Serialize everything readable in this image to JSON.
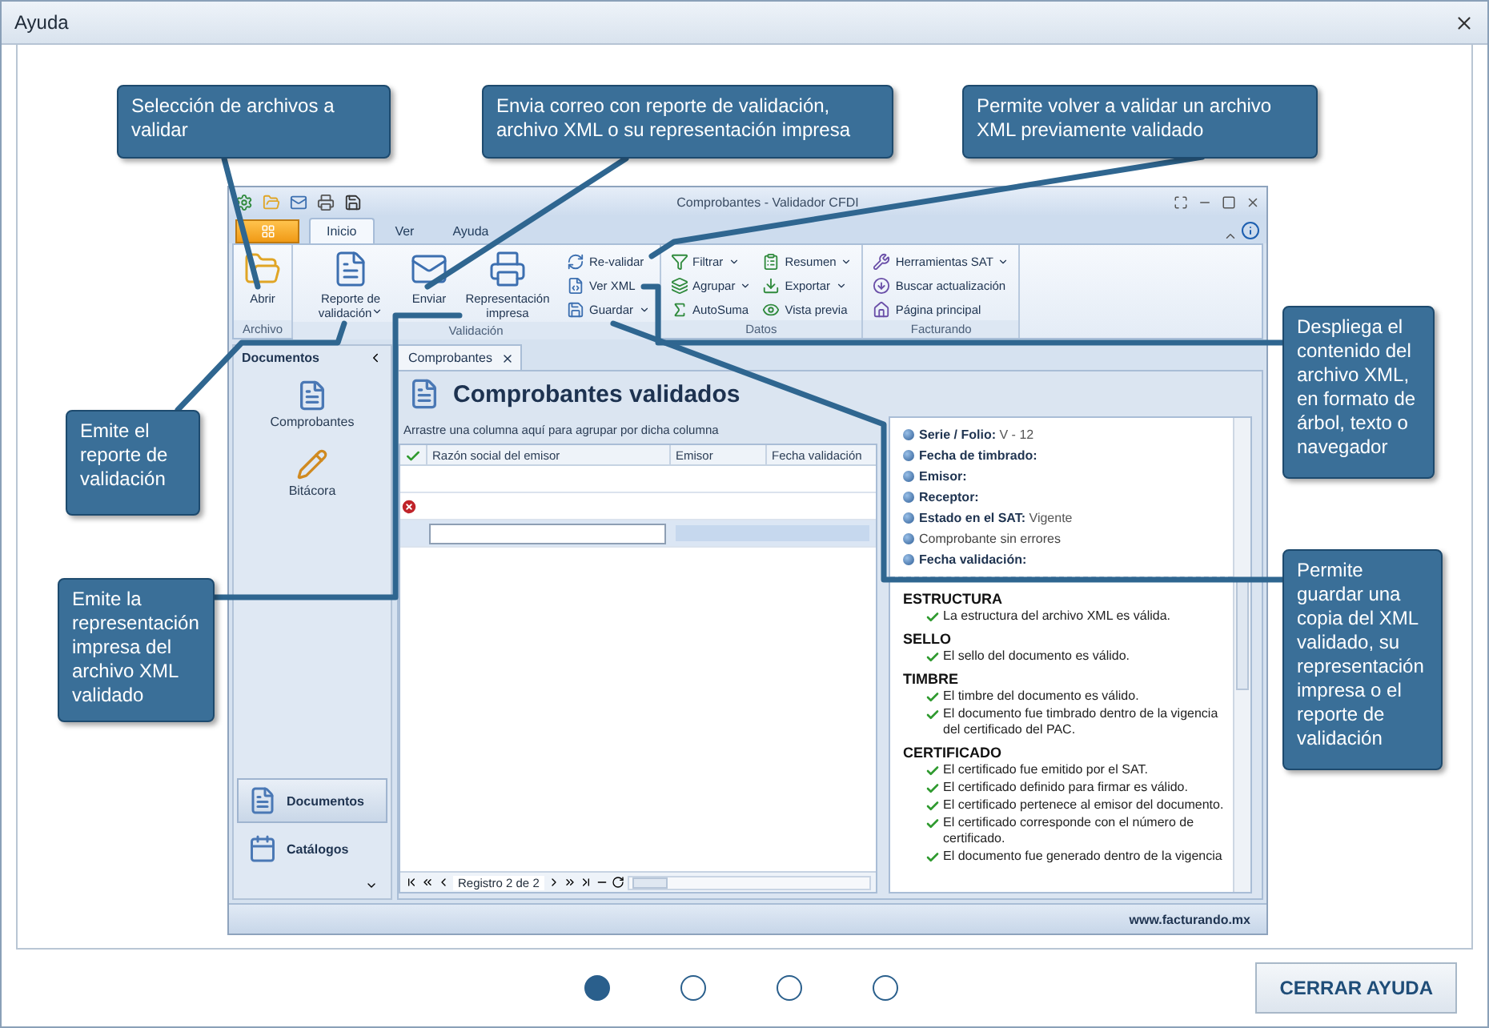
{
  "window": {
    "title": "Ayuda"
  },
  "app": {
    "title": "Comprobantes - Validador CFDI",
    "tabs": [
      {
        "label": "Inicio",
        "selected": true
      },
      {
        "label": "Ver",
        "selected": false
      },
      {
        "label": "Ayuda",
        "selected": false
      }
    ],
    "ribbon": [
      {
        "label": "Archivo",
        "items": [
          {
            "label": "Abrir",
            "kind": "large",
            "dropdown": false
          }
        ]
      },
      {
        "label": "Validación",
        "items": [
          {
            "label": "Reporte de validación",
            "kind": "large",
            "dropdown": true
          },
          {
            "label": "Enviar",
            "kind": "large",
            "dropdown": false
          },
          {
            "label": "Representación impresa",
            "kind": "large",
            "dropdown": false
          },
          {
            "label": "Re-validar",
            "kind": "small",
            "dropdown": false
          },
          {
            "label": "Ver XML",
            "kind": "small",
            "dropdown": false
          },
          {
            "label": "Guardar",
            "kind": "small",
            "dropdown": true
          }
        ]
      },
      {
        "label": "Datos",
        "items": [
          {
            "label": "Filtrar",
            "kind": "small",
            "dropdown": true
          },
          {
            "label": "Agrupar",
            "kind": "small",
            "dropdown": true
          },
          {
            "label": "AutoSuma",
            "kind": "small",
            "dropdown": false
          },
          {
            "label": "Resumen",
            "kind": "small",
            "dropdown": true
          },
          {
            "label": "Exportar",
            "kind": "small",
            "dropdown": true
          },
          {
            "label": "Vista previa",
            "kind": "small",
            "dropdown": false
          }
        ]
      },
      {
        "label": "Facturando",
        "items": [
          {
            "label": "Herramientas SAT",
            "kind": "small",
            "dropdown": true
          },
          {
            "label": "Buscar actualización",
            "kind": "small",
            "dropdown": false
          },
          {
            "label": "Página principal",
            "kind": "small",
            "dropdown": false
          }
        ]
      }
    ],
    "nav": {
      "header": "Documentos",
      "items": [
        {
          "label": "Comprobantes"
        },
        {
          "label": "Bitácora"
        }
      ],
      "sections": [
        {
          "label": "Documentos",
          "selected": true
        },
        {
          "label": "Catálogos",
          "selected": false
        }
      ]
    },
    "doc_tab": "Comprobantes",
    "heading": "Comprobantes validados",
    "group_hint": "Arrastre una columna aquí para agrupar por dicha columna",
    "columns": [
      "Razón social del emisor",
      "Emisor",
      "Fecha validación"
    ],
    "rows": [
      {
        "kind": "blank",
        "selected": false
      },
      {
        "kind": "error",
        "selected": false
      },
      {
        "kind": "editing",
        "selected": true
      }
    ],
    "navigator": "Registro 2 de 2",
    "summary": [
      {
        "kind": "field",
        "label": "Serie / Folio:",
        "value": "V - 12"
      },
      {
        "kind": "field",
        "label": "Fecha de timbrado:"
      },
      {
        "kind": "field",
        "label": "Emisor:"
      },
      {
        "kind": "field",
        "label": "Receptor:"
      },
      {
        "kind": "field",
        "label": "Estado en el SAT:",
        "value": "Vigente"
      },
      {
        "kind": "note",
        "label": "Comprobante sin errores"
      },
      {
        "kind": "field",
        "label": "Fecha validación:"
      }
    ],
    "sections": [
      {
        "title": "ESTRUCTURA",
        "checks": [
          "La estructura del archivo XML es válida."
        ]
      },
      {
        "title": "SELLO",
        "checks": [
          "El sello del documento es válido."
        ]
      },
      {
        "title": "TIMBRE",
        "checks": [
          "El timbre del documento es válido.",
          "El documento fue timbrado dentro de la vigencia del certificado del PAC."
        ]
      },
      {
        "title": "CERTIFICADO",
        "checks": [
          "El certificado fue emitido por el SAT.",
          "El certificado definido para firmar es válido.",
          "El certificado pertenece al emisor del documento.",
          "El certificado corresponde con el número de certificado.",
          "El documento fue generado dentro de la vigencia"
        ]
      }
    ],
    "status": "www.facturando.mx"
  },
  "callouts": [
    {
      "text": "Selección de archivos a validar"
    },
    {
      "text": "Envia correo con reporte de validación, archivo XML o su representación impresa"
    },
    {
      "text": "Permite volver a validar un archivo XML previamente validado"
    },
    {
      "text": "Despliega el contenido del archivo XML, en formato de árbol, texto o navegador"
    },
    {
      "text": "Emite el reporte de validación"
    },
    {
      "text": "Emite la representación impresa del archivo XML validado"
    },
    {
      "text": "Permite guardar una copia del XML validado, su representación impresa o el reporte de validación"
    }
  ],
  "pager": [
    {
      "selected": true
    },
    {
      "selected": false
    },
    {
      "selected": false
    },
    {
      "selected": false
    }
  ],
  "close_button": "CERRAR AYUDA"
}
